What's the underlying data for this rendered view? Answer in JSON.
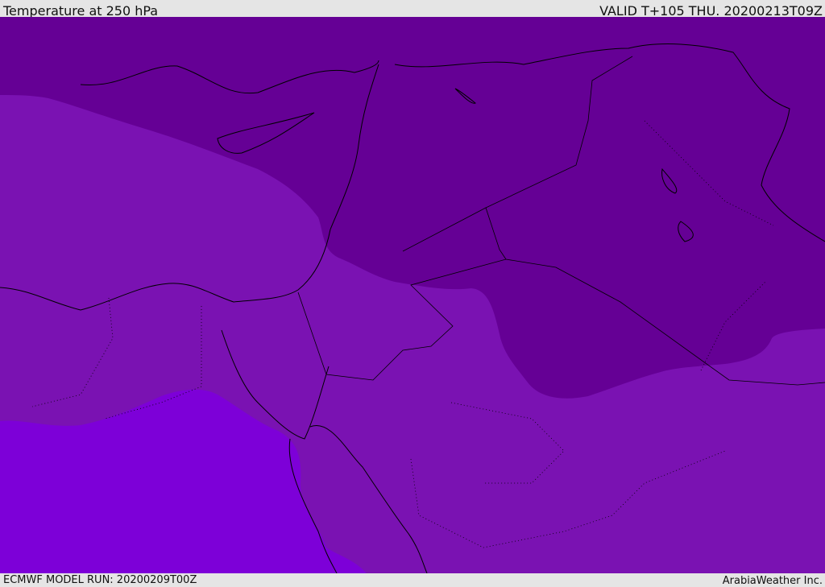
{
  "header": {
    "title": "Temperature at 250 hPa",
    "valid": "VALID T+105 THU. 20200213T09Z"
  },
  "footer": {
    "model_run": "ECMWF MODEL RUN: 20200209T00Z",
    "credit": "ArabiaWeather Inc."
  },
  "colors": {
    "cold_dark": "#650095",
    "mid": "#7a12b2",
    "warm_bright": "#7d00d8",
    "border": "#000000"
  }
}
